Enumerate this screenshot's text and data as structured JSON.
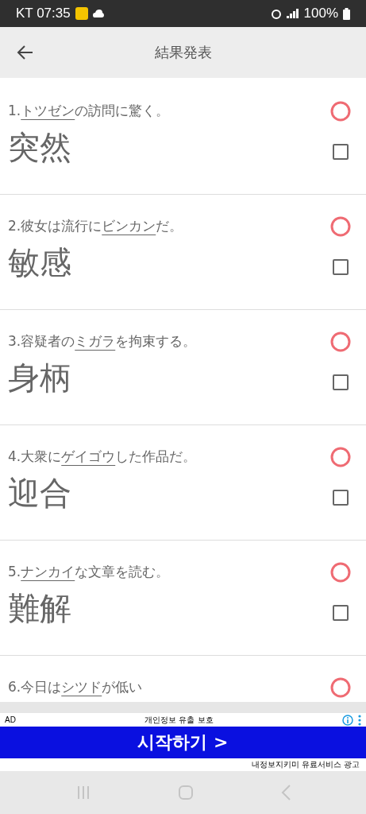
{
  "status_bar": {
    "carrier_time": "KT 07:35",
    "battery": "100%"
  },
  "header": {
    "title": "結果発表"
  },
  "questions": [
    {
      "number": "1.",
      "target": "トツゼン",
      "after": "の訪問に驚く。",
      "answer": "突然",
      "kind": "correct",
      "checked": false
    },
    {
      "number": "2.",
      "before": "彼女は流行に",
      "target": "ビンカン",
      "after": "だ。",
      "answer": "敏感",
      "kind": "correct",
      "checked": false
    },
    {
      "number": "3.",
      "before": "容疑者の",
      "target": "ミガラ",
      "after": "を拘束する。",
      "answer": "身柄",
      "kind": "correct",
      "checked": false
    },
    {
      "number": "4.",
      "before": "大衆に",
      "target": "ゲイゴウ",
      "after": "した作品だ。",
      "answer": "迎合",
      "kind": "correct",
      "checked": false
    },
    {
      "number": "5.",
      "target": "ナンカイ",
      "after": "な文章を読む。",
      "answer": "難解",
      "kind": "correct",
      "checked": false
    },
    {
      "number": "6.",
      "before": "今日は",
      "target": "シツド",
      "after": "が低い",
      "kind": "correct"
    }
  ],
  "ad": {
    "label": "AD",
    "title": "개인정보 유출 보호",
    "button": "시작하기 >",
    "footer": "내정보지키미 유료서비스 광고"
  }
}
